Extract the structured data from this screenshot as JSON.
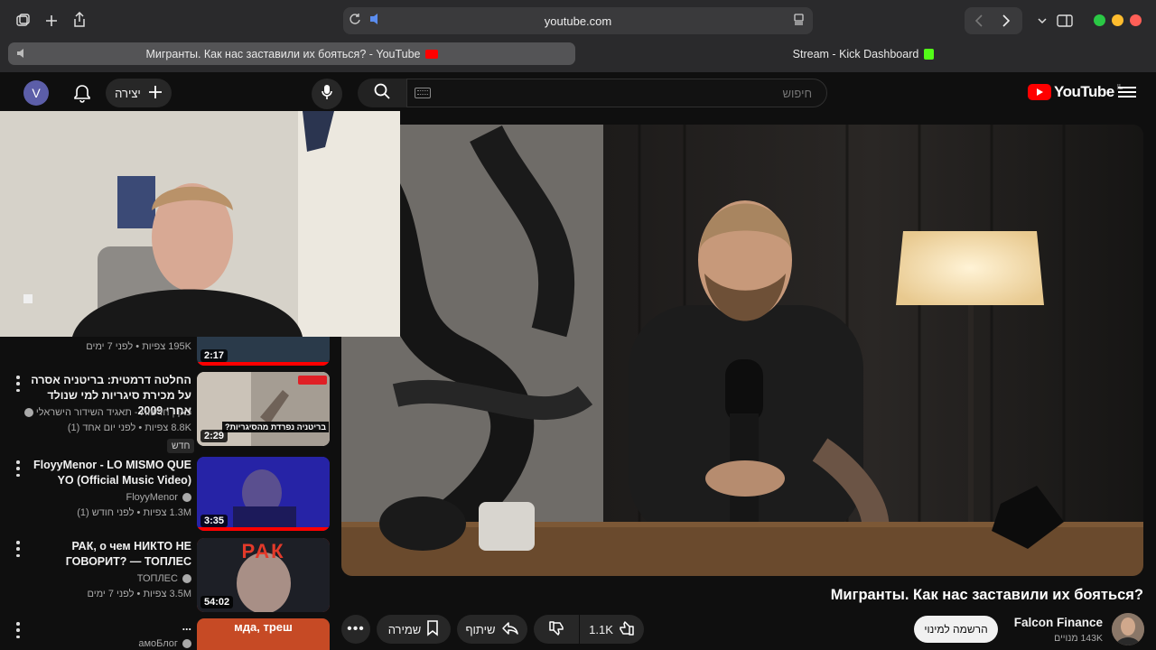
{
  "browser": {
    "url": "youtube.com",
    "tabs": [
      {
        "title": "Мигранты. Как нас заставили их бояться? - YouTube",
        "active": true
      },
      {
        "title": "Stream - Kick Dashboard",
        "active": false
      }
    ]
  },
  "header": {
    "avatar_letter": "V",
    "create_label": "יצירה",
    "search_placeholder": "חיפוש",
    "logo_text": "YouTube",
    "logo_country": "IL"
  },
  "recommendations": [
    {
      "title": "",
      "meta1": "",
      "meta2": "195K צפיות • לפני 7 ימים",
      "duration": "2:17",
      "thumb_color": "#2a3a4a"
    },
    {
      "title": "החלטה דרמטית: בריטניה אסרה על מכירת סיגריות למי שנולד אחרי 2009",
      "meta1": "כאן | חדשות - תאגיד השידור הישראלי",
      "meta2": "8.8K צפיות • לפני יום אחד (1)",
      "badge": "חדש",
      "duration": "2:29",
      "thumb_color": "#c9c2b8",
      "thumb_caption": "בריטניה נפרדת מהסיגריות?"
    },
    {
      "title": "FloyyMenor - LO MISMO QUE YO (Official Music Video)",
      "meta1": "FloyyMenor",
      "meta2": "1.3M צפיות • לפני חודש (1)",
      "duration": "3:35",
      "thumb_color": "#2b2ba8"
    },
    {
      "title": "РАК, о чем НИКТО НЕ ГОВОРИТ? — ТОПЛЕС",
      "meta1": "ТОПЛЕС",
      "meta2": "3.5M צפיות • לפני 7 ימים",
      "duration": "54:02",
      "thumb_color": "#d53a2c",
      "thumb_caption": "РАК"
    },
    {
      "title": "...",
      "meta1": "амоБлог",
      "meta2": "",
      "duration": "",
      "thumb_color": "#c64a25",
      "thumb_caption": "мда, треш"
    }
  ],
  "video": {
    "title": "Мигранты. Как нас заставили их бояться?",
    "likes": "1.1K",
    "share_label": "שיתוף",
    "save_label": "שמירה",
    "subscribe_label": "הרשמה למינוי",
    "channel_name": "Falcon Finance",
    "channel_subs": "143K מנויים"
  },
  "colors": {
    "accent_red": "#ff0000",
    "kick_green": "#53fc18"
  }
}
